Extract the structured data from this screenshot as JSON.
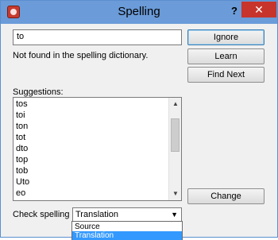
{
  "window": {
    "title": "Spelling",
    "help_label": "?",
    "close_label": "✕"
  },
  "word_field": {
    "value": "to"
  },
  "status_text": "Not found in the spelling dictionary.",
  "buttons": {
    "ignore": "Ignore",
    "learn": "Learn",
    "find_next": "Find Next",
    "change": "Change"
  },
  "suggestions": {
    "label": "Suggestions:",
    "items": [
      "tos",
      "toi",
      "ton",
      "tot",
      "dto",
      "top",
      "tob",
      "Uto",
      "eo"
    ],
    "scroll_up_icon": "▲",
    "scroll_down_icon": "▼"
  },
  "check_in": {
    "label": "Check spelling in:",
    "selected": "Translation",
    "options": [
      "Source",
      "Translation"
    ],
    "dropdown_icon": "▼"
  },
  "colors": {
    "titlebar": "#6b9bd8",
    "close": "#c7342b",
    "selection": "#3399ff"
  }
}
